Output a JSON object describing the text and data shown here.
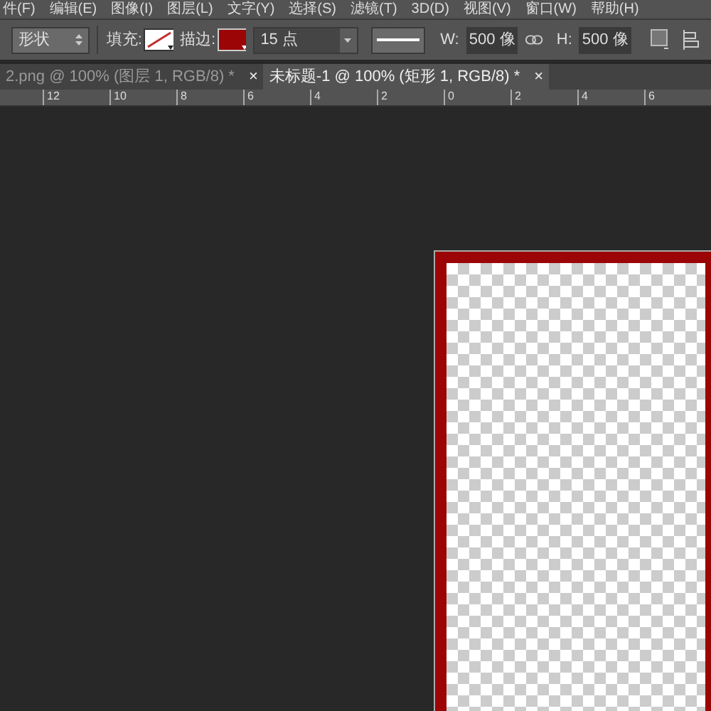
{
  "menu": [
    "件(F)",
    "编辑(E)",
    "图像(I)",
    "图层(L)",
    "文字(Y)",
    "选择(S)",
    "滤镜(T)",
    "3D(D)",
    "视图(V)",
    "窗口(W)",
    "帮助(H)"
  ],
  "options": {
    "mode": "形状",
    "fill_label": "填充:",
    "stroke_label": "描边:",
    "stroke_width": "15 点",
    "w_label": "W:",
    "w_value": "500 像",
    "h_label": "H:",
    "h_value": "500 像"
  },
  "tabs": [
    {
      "label": "2.png @ 100% (图层 1, RGB/8) *",
      "close": "×",
      "selected": false
    },
    {
      "label": "未标题-1 @ 100% (矩形 1, RGB/8) *",
      "close": "×",
      "selected": true
    }
  ],
  "ruler": [
    "12",
    "10",
    "8",
    "6",
    "4",
    "2",
    "0",
    "2",
    "4",
    "6"
  ]
}
